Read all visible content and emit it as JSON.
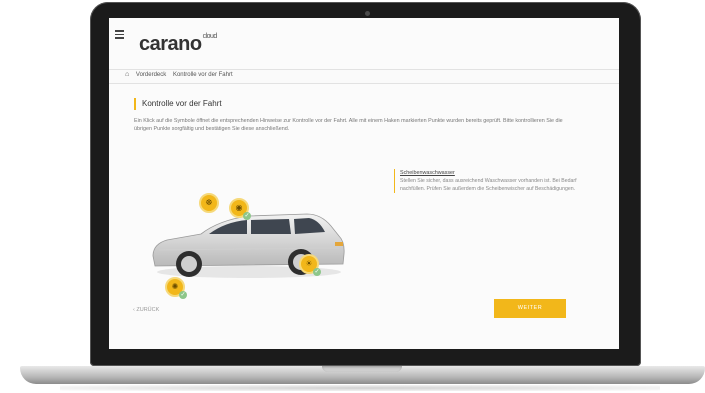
{
  "app": {
    "logo_main": "carano",
    "logo_sup": "cloud"
  },
  "breadcrumb": {
    "items": [
      "Vorderdeck",
      "Kontrolle vor der Fahrt"
    ]
  },
  "page": {
    "title": "Kontrolle vor der Fahrt",
    "intro": "Ein Klick auf die Symbole öffnet die entsprechenden Hinweise zur Kontrolle vor der Fahrt. Alle mit einem Haken markierten Punkte wurden bereits geprüft. Bitte kontrollieren Sie die übrigen Punkte sorgfältig und bestätigen Sie diese anschließend."
  },
  "info": {
    "title": "Scheibenwaschwasser",
    "text": "Stellen Sie sicher, dass ausreichend Waschwasser vorhanden ist. Bei Bedarf nachfüllen. Prüfen Sie außerdem die Scheibenwischer auf Beschädigungen."
  },
  "nav": {
    "back_label": "‹ ZURÜCK",
    "next_label": "WEITER"
  },
  "markers": [
    {
      "name": "steering-wheel",
      "checked": false
    },
    {
      "name": "dashboard",
      "checked": true
    },
    {
      "name": "wheel-front",
      "checked": true
    },
    {
      "name": "light",
      "checked": true
    }
  ],
  "colors": {
    "accent": "#f2b71a",
    "check": "#8dc68a"
  }
}
